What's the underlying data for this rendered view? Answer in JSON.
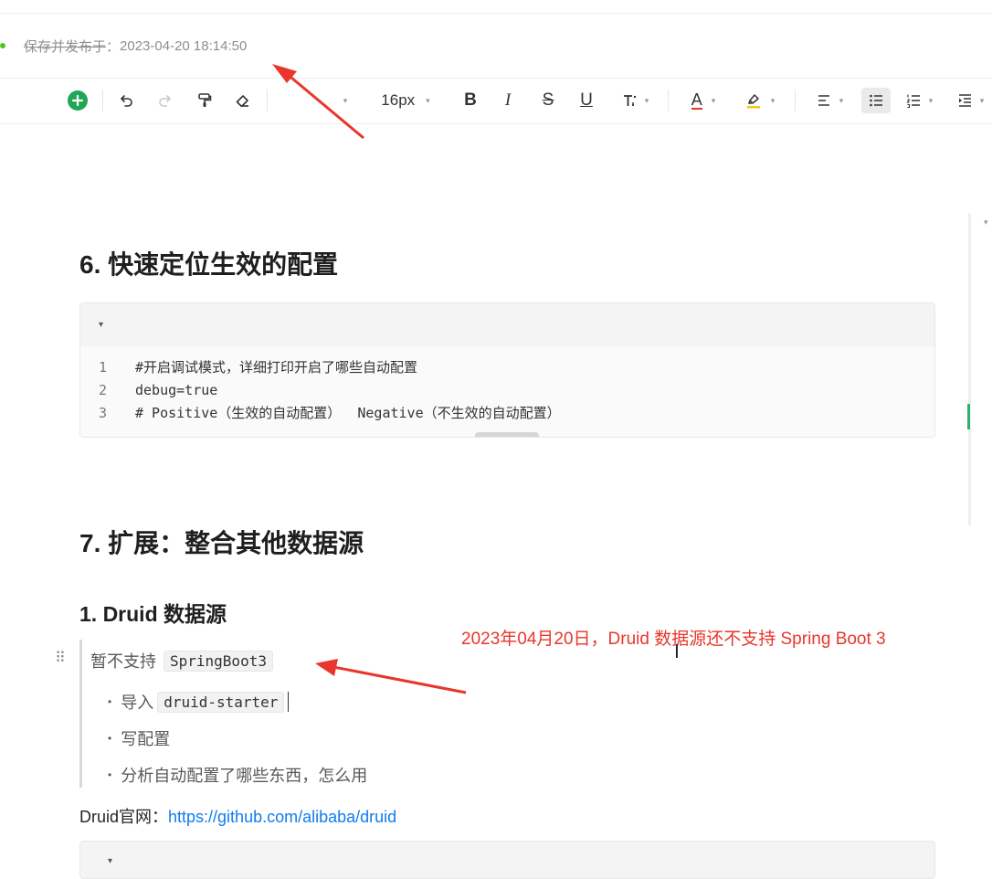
{
  "status": {
    "label": "保存并发布于",
    "separator": "：",
    "timestamp": "2023-04-20 18:14:50"
  },
  "toolbar": {
    "add_icon": "plus-circle-icon",
    "font_size": "16px",
    "bold": "B",
    "italic": "I",
    "strike": "S",
    "underline": "U",
    "font_color_label": "A",
    "caret": "▾",
    "accent_color": "#52c41a",
    "annotation_color": "#e8362b"
  },
  "sections": {
    "h6": "6. 快速定位生效的配置",
    "h7": "7. 扩展：整合其他数据源",
    "h7_1": "1. Druid 数据源"
  },
  "codeblock1": {
    "lines": [
      {
        "num": "1",
        "code": "#开启调试模式，详细打印开启了哪些自动配置"
      },
      {
        "num": "2",
        "code": "debug=true"
      },
      {
        "num": "3",
        "code": "# Positive（生效的自动配置）  Negative（不生效的自动配置）"
      }
    ]
  },
  "quote": {
    "text": "暂不支持",
    "code": "SpringBoot3",
    "items": [
      {
        "text": "导入",
        "code": "druid-starter"
      },
      {
        "text": "写配置"
      },
      {
        "text": "分析自动配置了哪些东西，怎么用"
      }
    ]
  },
  "link_line": {
    "label": "Druid官网：",
    "url": "https://github.com/alibaba/druid"
  },
  "annotation": "2023年04月20日，Druid 数据源还不支持 Spring Boot 3"
}
